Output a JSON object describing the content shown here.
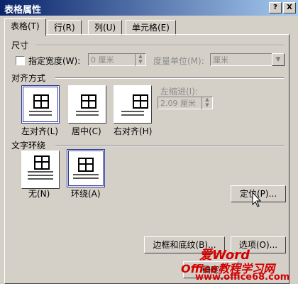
{
  "window": {
    "title": "表格属性",
    "help_btn": "?",
    "close_btn": "X"
  },
  "tabs": [
    {
      "label": "表格(T)",
      "active": true
    },
    {
      "label": "行(R)",
      "active": false
    },
    {
      "label": "列(U)",
      "active": false
    },
    {
      "label": "单元格(E)",
      "active": false
    }
  ],
  "size": {
    "section": "尺寸",
    "width_check_label": "指定宽度(W):",
    "width_value": "0 厘米",
    "unit_label": "度量单位(M):",
    "unit_value": "厘米"
  },
  "alignment": {
    "section": "对齐方式",
    "options": [
      "左对齐(L)",
      "居中(C)",
      "右对齐(H)"
    ],
    "selected": "左对齐(L)",
    "indent_label": "左缩进(I):",
    "indent_value": "2.09 厘米"
  },
  "wrapping": {
    "section": "文字环绕",
    "options": [
      "无(N)",
      "环绕(A)"
    ],
    "selected": "环绕(A)",
    "position_button": "定位(P)..."
  },
  "footer": {
    "borders_button": "边框和底纹(B)...",
    "options_button": "选项(O)...",
    "ok_button": "确定"
  },
  "watermark": {
    "top": "爱Word",
    "brand": "Office教程学习网",
    "url": "www.office68.com"
  }
}
